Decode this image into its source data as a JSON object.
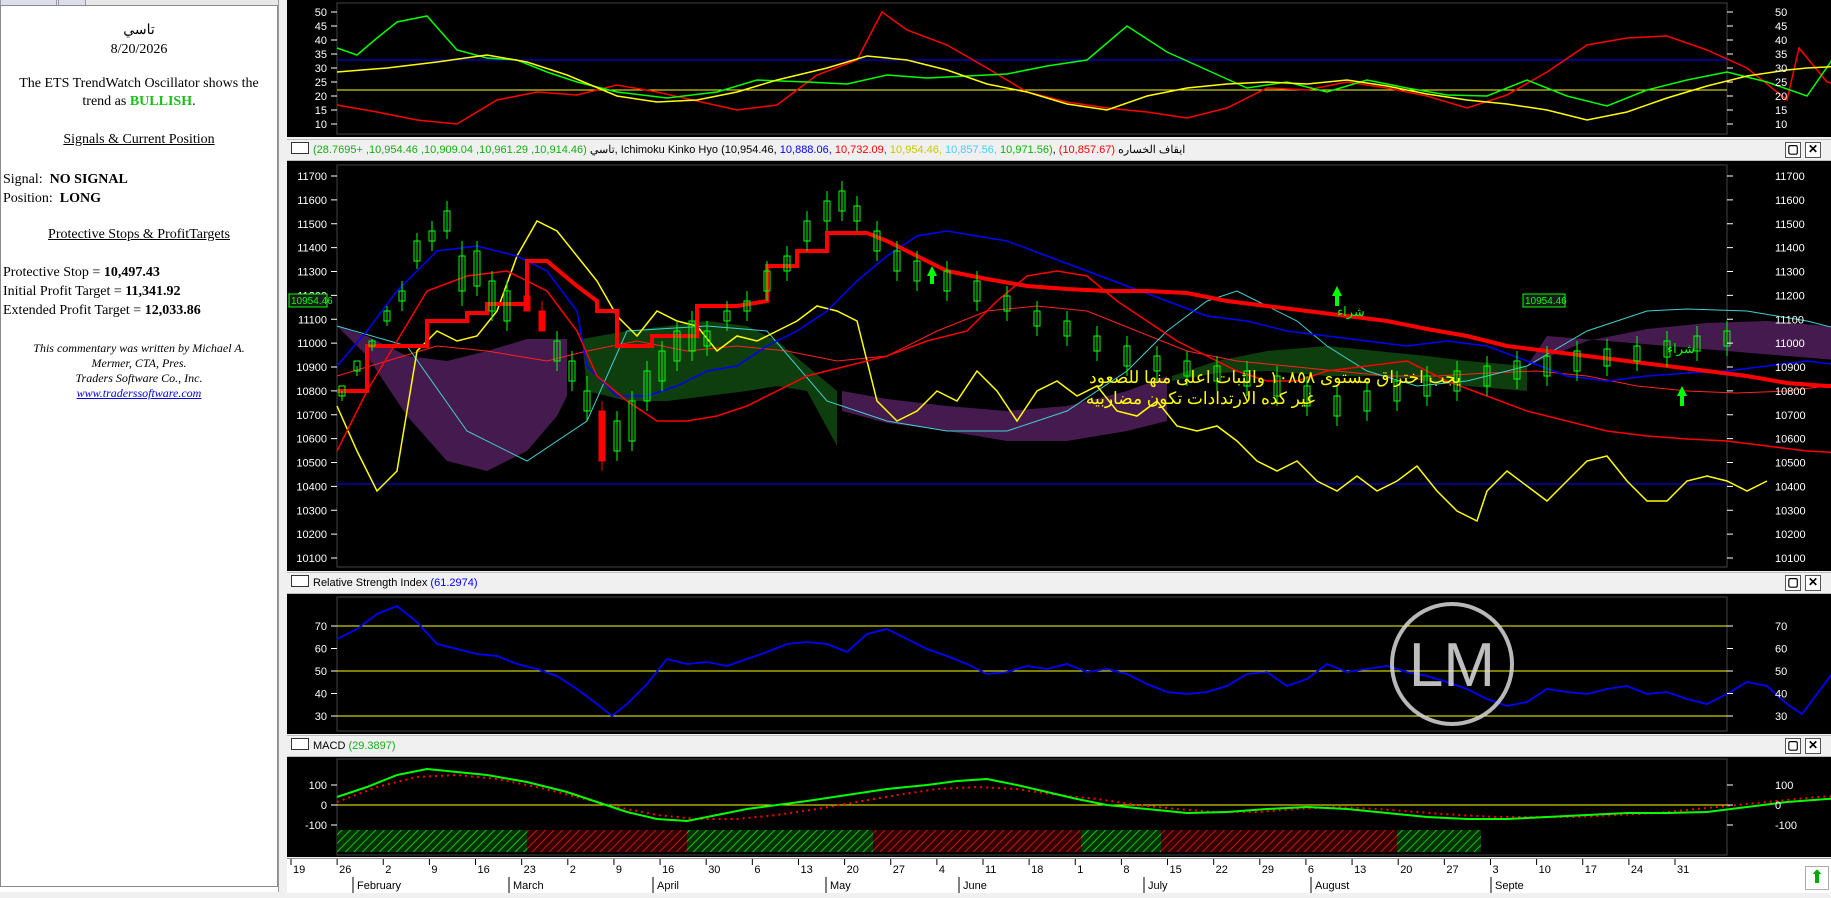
{
  "sidebar": {
    "title": "تاسي",
    "date": "8/20/2026",
    "trend_line1": "The ETS TrendWatch Oscillator shows the",
    "trend_line2_prefix": "trend as",
    "trend_value": "BULLISH",
    "trend_suffix": ".",
    "signals_heading": "Signals & Current Position",
    "signal_label": "Signal:",
    "signal_value": "NO SIGNAL",
    "position_label": "Position:",
    "position_value": "LONG",
    "stops_heading": "Protective Stops & ProfitTargets",
    "protective_stop_label": "Protective Stop =",
    "protective_stop_value": "10,497.43",
    "initial_target_label": "Initial Profit Target =",
    "initial_target_value": "11,341.92",
    "extended_target_label": "Extended Profit Target =",
    "extended_target_value": "12,033.86",
    "commentary_1": "This commentary was written by Michael A.",
    "commentary_2": "Mermer, CTA, Pres.",
    "commentary_3": "Traders Software Co., Inc.",
    "website": "www.traderssoftware.com"
  },
  "oscillator_panel": {
    "y_ticks": [
      "50",
      "45",
      "40",
      "35",
      "30",
      "25",
      "20",
      "15",
      "10"
    ]
  },
  "price_panel": {
    "title_symbol": "تاسي",
    "ohlc": "(10,914.46, 10,961.29, 10,909.04, 10,954.46, +28.7695)",
    "indicator": "Ichimoku Kinko Hyo",
    "ichimoku_v1": "(10,954.46,",
    "ichimoku_v2": "10,888.06,",
    "ichimoku_v3": "10,732.09,",
    "ichimoku_v4": "10,954.46,",
    "ichimoku_v5": "10,857.56,",
    "ichimoku_v6": "10,971.56)",
    "stoploss_label": "ايقاف الخساره",
    "stoploss_value": "(10,857.67)",
    "last_price": "10954.46",
    "y_ticks": [
      "11700",
      "11600",
      "11500",
      "11400",
      "11300",
      "11200",
      "11100",
      "11000",
      "10900",
      "10800",
      "10700",
      "10600",
      "10500",
      "10400",
      "10300",
      "10200",
      "10100"
    ],
    "note_line1": "يجب اختراق مستوى ١٠٨٥٨ والثبات اعلى منها للصعود",
    "note_line2": "غير كده الارتدادات تكون مضاربيه",
    "buy_label": "شراء"
  },
  "rsi_panel": {
    "title": "Relative Strength Index",
    "value": "(61.2974)",
    "y_ticks": [
      "70",
      "60",
      "50",
      "40",
      "30"
    ]
  },
  "macd_panel": {
    "title": "MACD",
    "value": "(29.3897)",
    "y_ticks": [
      "100",
      "0",
      "-100"
    ]
  },
  "time_axis": {
    "days": [
      "19",
      "26",
      "2",
      "9",
      "16",
      "23",
      "2",
      "9",
      "16",
      "30",
      "6",
      "13",
      "20",
      "27",
      "4",
      "11",
      "18",
      "1",
      "8",
      "15",
      "22",
      "29",
      "6",
      "13",
      "20",
      "27",
      "3",
      "10",
      "17",
      "24",
      "31"
    ],
    "months": [
      "February",
      "March",
      "April",
      "May",
      "June",
      "July",
      "August",
      "Septe"
    ]
  },
  "watermark": "LM",
  "colors": {
    "bullish": "#19c019",
    "chart_bg": "#000000",
    "price_red": "#ff0000",
    "kijun_blue": "#0000ff",
    "tenkan_yellow": "#ffff00",
    "note_yellow": "#ffff00"
  }
}
